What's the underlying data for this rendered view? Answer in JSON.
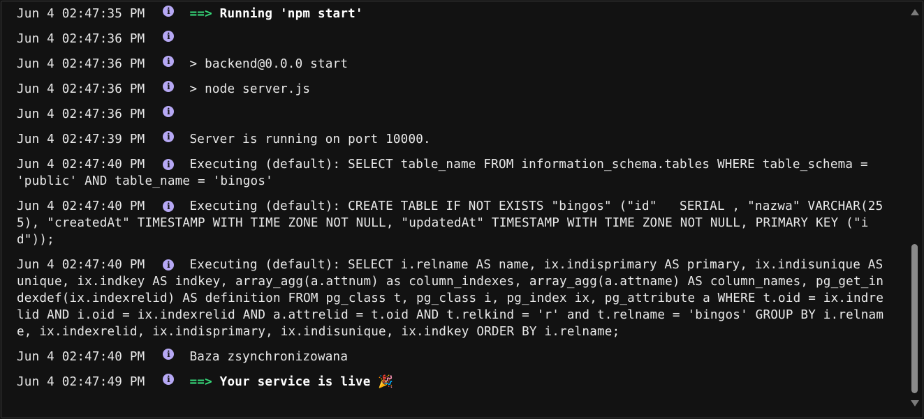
{
  "log": {
    "entries": [
      {
        "ts": "Jun 4 02:47:35 PM",
        "arrow": "==>",
        "text": " Running 'npm start'"
      },
      {
        "ts": "Jun 4 02:47:36 PM",
        "text": ""
      },
      {
        "ts": "Jun 4 02:47:36 PM",
        "text": "> backend@0.0.0 start"
      },
      {
        "ts": "Jun 4 02:47:36 PM",
        "text": "> node server.js"
      },
      {
        "ts": "Jun 4 02:47:36 PM",
        "text": ""
      },
      {
        "ts": "Jun 4 02:47:39 PM",
        "text": "Server is running on port 10000."
      },
      {
        "ts": "Jun 4 02:47:40 PM",
        "text": "Executing (default): SELECT table_name FROM information_schema.tables WHERE table_schema = 'public' AND table_name = 'bingos'"
      },
      {
        "ts": "Jun 4 02:47:40 PM",
        "text": "Executing (default): CREATE TABLE IF NOT EXISTS \"bingos\" (\"id\"   SERIAL , \"nazwa\" VARCHAR(255), \"createdAt\" TIMESTAMP WITH TIME ZONE NOT NULL, \"updatedAt\" TIMESTAMP WITH TIME ZONE NOT NULL, PRIMARY KEY (\"id\"));"
      },
      {
        "ts": "Jun 4 02:47:40 PM",
        "text": "Executing (default): SELECT i.relname AS name, ix.indisprimary AS primary, ix.indisunique AS unique, ix.indkey AS indkey, array_agg(a.attnum) as column_indexes, array_agg(a.attname) AS column_names, pg_get_indexdef(ix.indexrelid) AS definition FROM pg_class t, pg_class i, pg_index ix, pg_attribute a WHERE t.oid = ix.indrelid AND i.oid = ix.indexrelid AND a.attrelid = t.oid AND t.relkind = 'r' and t.relname = 'bingos' GROUP BY i.relname, ix.indexrelid, ix.indisprimary, ix.indisunique, ix.indkey ORDER BY i.relname;"
      },
      {
        "ts": "Jun 4 02:47:40 PM",
        "text": "Baza zsynchronizowana"
      },
      {
        "ts": "Jun 4 02:47:49 PM",
        "arrow": "==>",
        "text": " Your service is live 🎉"
      }
    ],
    "info_icon": "info-icon",
    "colors": {
      "background": "#121212",
      "text": "#e9e9e9",
      "arrow": "#36d97a",
      "info_icon": "#b6a8f4"
    }
  },
  "scrollbar": {
    "position_fraction": 1.0
  }
}
